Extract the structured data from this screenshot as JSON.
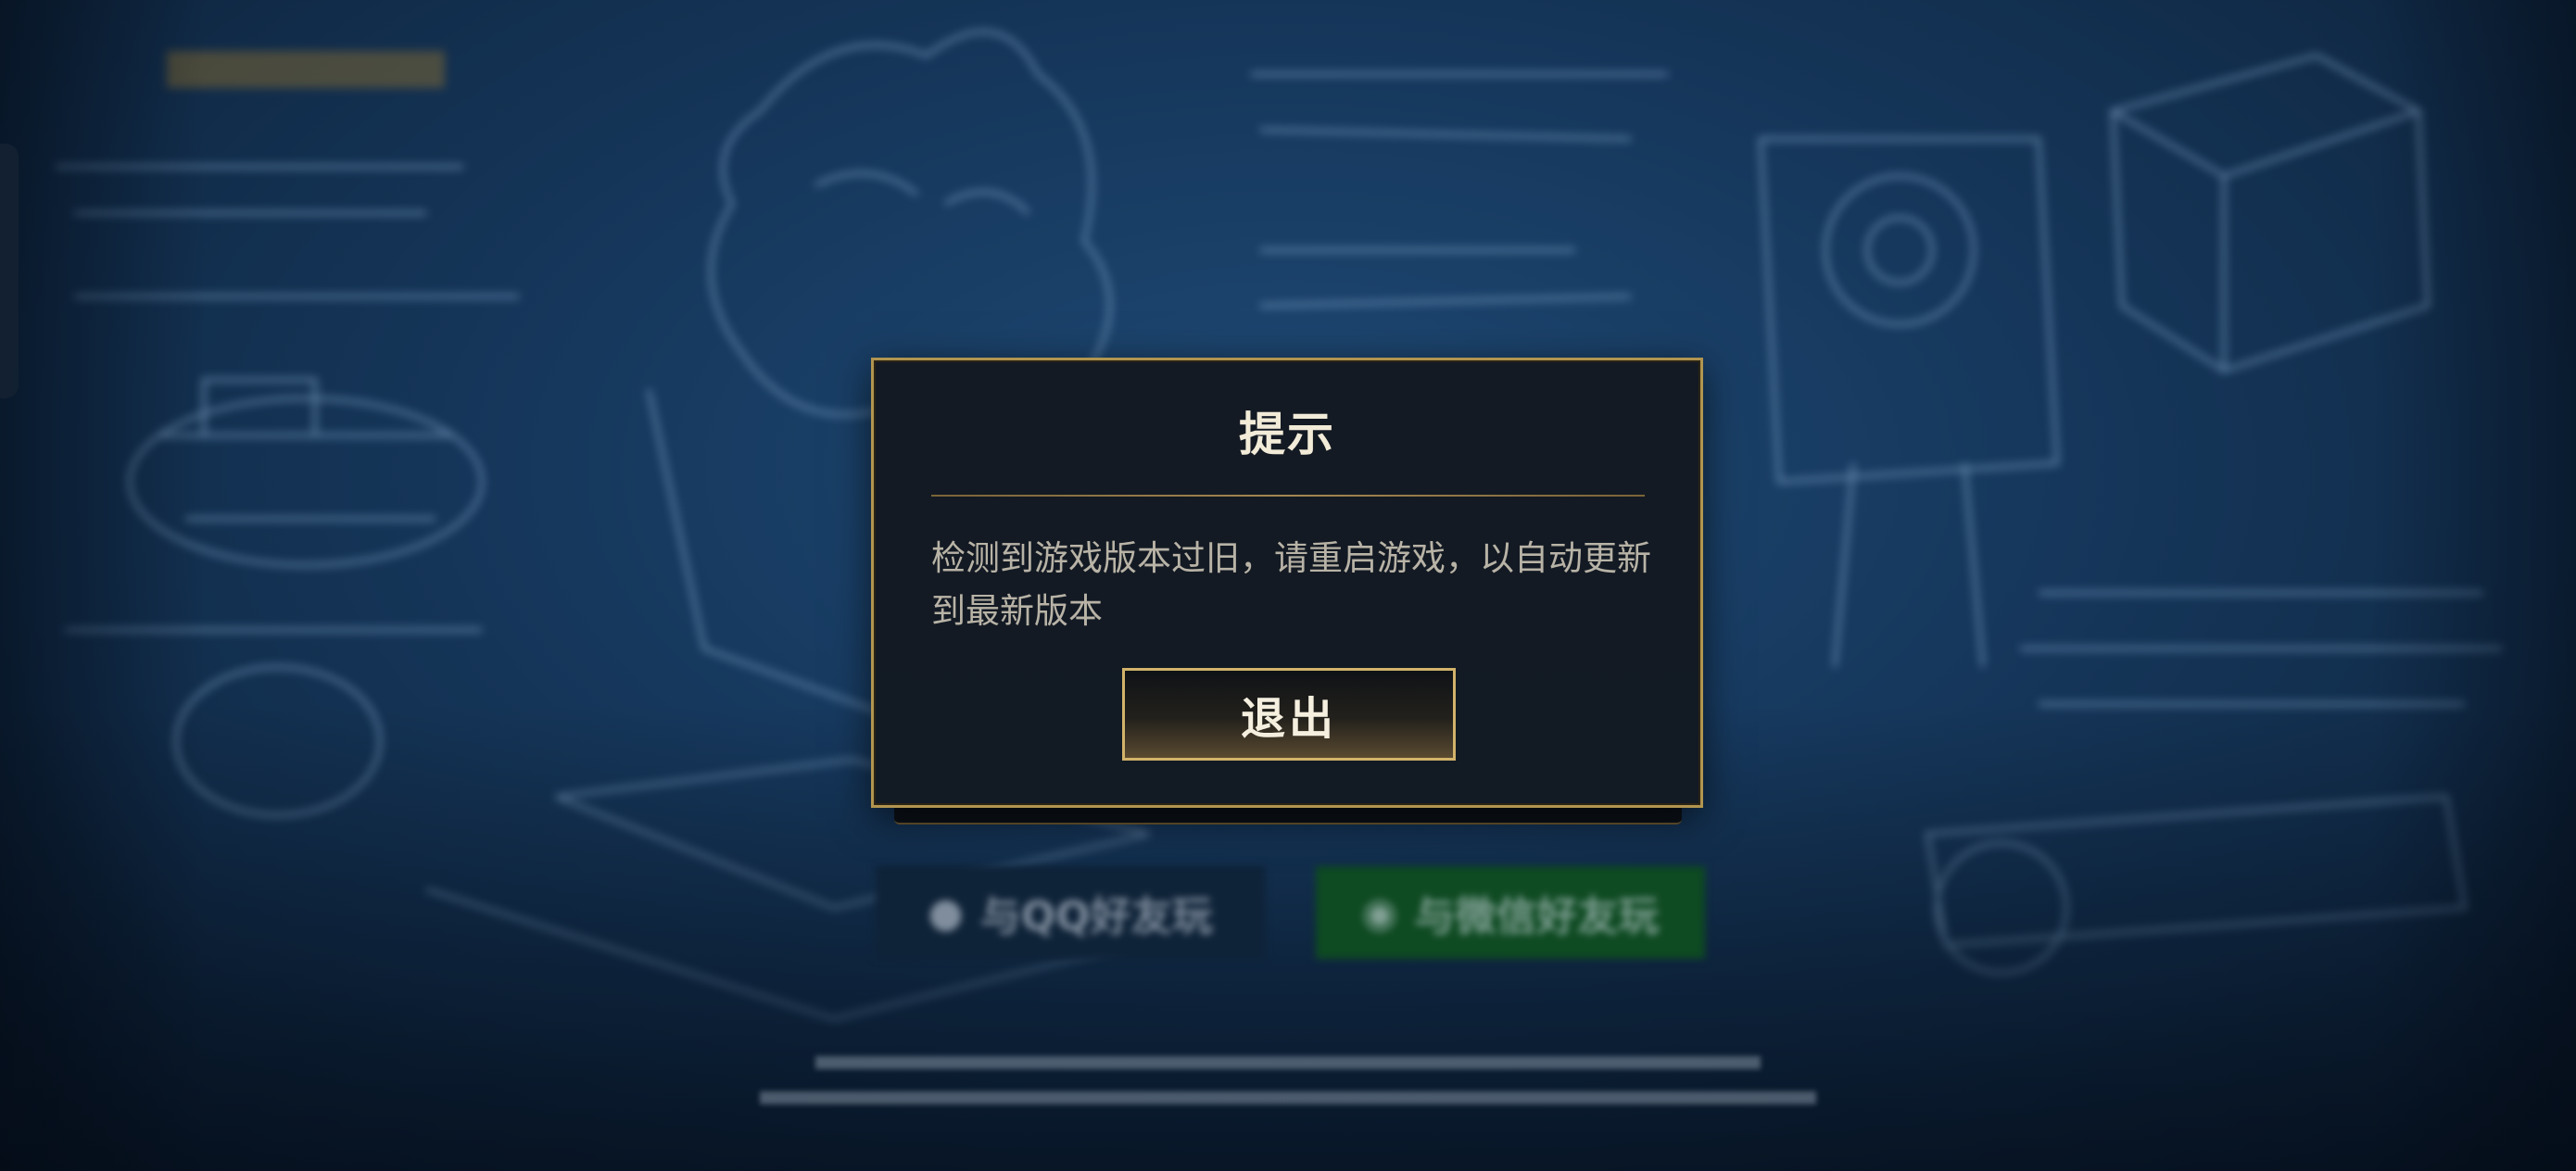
{
  "dialog": {
    "title": "提示",
    "message_line1": "检测到游戏版本过旧，请重启游戏，以自动更新",
    "message_line2": "到最新版本",
    "exit_label": "退出"
  },
  "background": {
    "login_qq_label": "与QQ好友玩",
    "login_wechat_label": "与微信好友玩"
  },
  "colors": {
    "dialog_border": "#b1954f",
    "dialog_bg": "#141a23",
    "button_border": "#d2b36a",
    "background_blue": "#1f4a75",
    "wechat_green": "#0e4a22"
  }
}
